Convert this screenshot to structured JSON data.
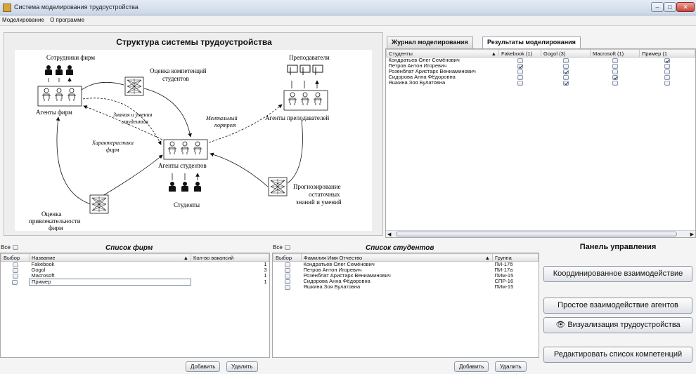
{
  "window": {
    "title": "Система моделирования трудоустройства",
    "min": "–",
    "max": "□",
    "close": "✕"
  },
  "menu": [
    "Моделирование",
    "О программе"
  ],
  "diagram": {
    "title": "Структура системы трудоустройства",
    "labels": {
      "employees": "Сотрудники фирм",
      "competence1": "Оценка компетенций",
      "competence2": "студентов",
      "teachers": "Преподаватели",
      "firm_agents": "Агенты фирм",
      "knowledge1": "Знания и умения",
      "knowledge2": "студентов",
      "mental1": "Ментальный",
      "mental2": "портрет",
      "teacher_agents": "Агенты преподавателей",
      "firm_chars1": "Характеристики",
      "firm_chars2": "фирм",
      "student_agents": "Агенты студентов",
      "forecast1": "Прогнозирование",
      "forecast2": "остаточных",
      "forecast3": "знаний и умений",
      "attract1": "Оценка",
      "attract2": "привлекательности",
      "attract3": "фирм",
      "students": "Студенты"
    }
  },
  "tabs": {
    "journal": "Журнал моделирования",
    "results": "Результаты моделирования"
  },
  "results": {
    "columns": [
      "Студенты",
      "Fakebook (1)",
      "Gogol (3)",
      "Macrosoft (1)",
      "Пример (1"
    ],
    "rows": [
      {
        "name": "Кондратьев Олег Семёнович",
        "checks": [
          false,
          false,
          false,
          true
        ]
      },
      {
        "name": "Петров Антон Игоревич",
        "checks": [
          true,
          false,
          false,
          false
        ]
      },
      {
        "name": "Розенблат Аристарх Вениаминович",
        "checks": [
          false,
          true,
          false,
          false
        ]
      },
      {
        "name": "Сидорова Анна Фёдоровна",
        "checks": [
          false,
          false,
          true,
          false
        ]
      },
      {
        "name": "Яшкина Зоя Булатовна",
        "checks": [
          false,
          true,
          false,
          false
        ]
      }
    ]
  },
  "firms": {
    "all_label": "Все",
    "title": "Список фирм",
    "columns": [
      "Выбор",
      "Название",
      "Кол-во вакансий"
    ],
    "rows": [
      {
        "name": "Fakebook",
        "vacancies": "1"
      },
      {
        "name": "Gogol",
        "vacancies": "3"
      },
      {
        "name": "Macrosoft",
        "vacancies": "1"
      },
      {
        "name": "Пример",
        "vacancies": "1"
      }
    ],
    "add": "Добавить",
    "delete": "Удалить"
  },
  "students": {
    "all_label": "Все",
    "title": "Список студентов",
    "columns": [
      "Выбор",
      "Фамилия Имя Отчество",
      "Группа"
    ],
    "rows": [
      {
        "name": "Кондратьев Олег Семёнович",
        "group": "ПИ-17б"
      },
      {
        "name": "Петров Антон Игоревич",
        "group": "ПИ-17а"
      },
      {
        "name": "Розенблат Аристарх Вениаминович",
        "group": "ПИм-15"
      },
      {
        "name": "Сидорова Анна Фёдоровна",
        "group": "СПР-16"
      },
      {
        "name": "Яшкина Зоя Булатовна",
        "group": "ПИм-15"
      }
    ],
    "add": "Добавить",
    "delete": "Удалить"
  },
  "control": {
    "title": "Панель управления",
    "coordinated": "Координированное взаимодействие",
    "simple": "Простое взаимодействие агентов",
    "visualize": "Визуализация трудоустройства",
    "edit": "Редактировать список компетенций"
  },
  "icons": {
    "app": "app-icon",
    "eye": "eye-icon",
    "sort": "sort-arrow-icon"
  }
}
